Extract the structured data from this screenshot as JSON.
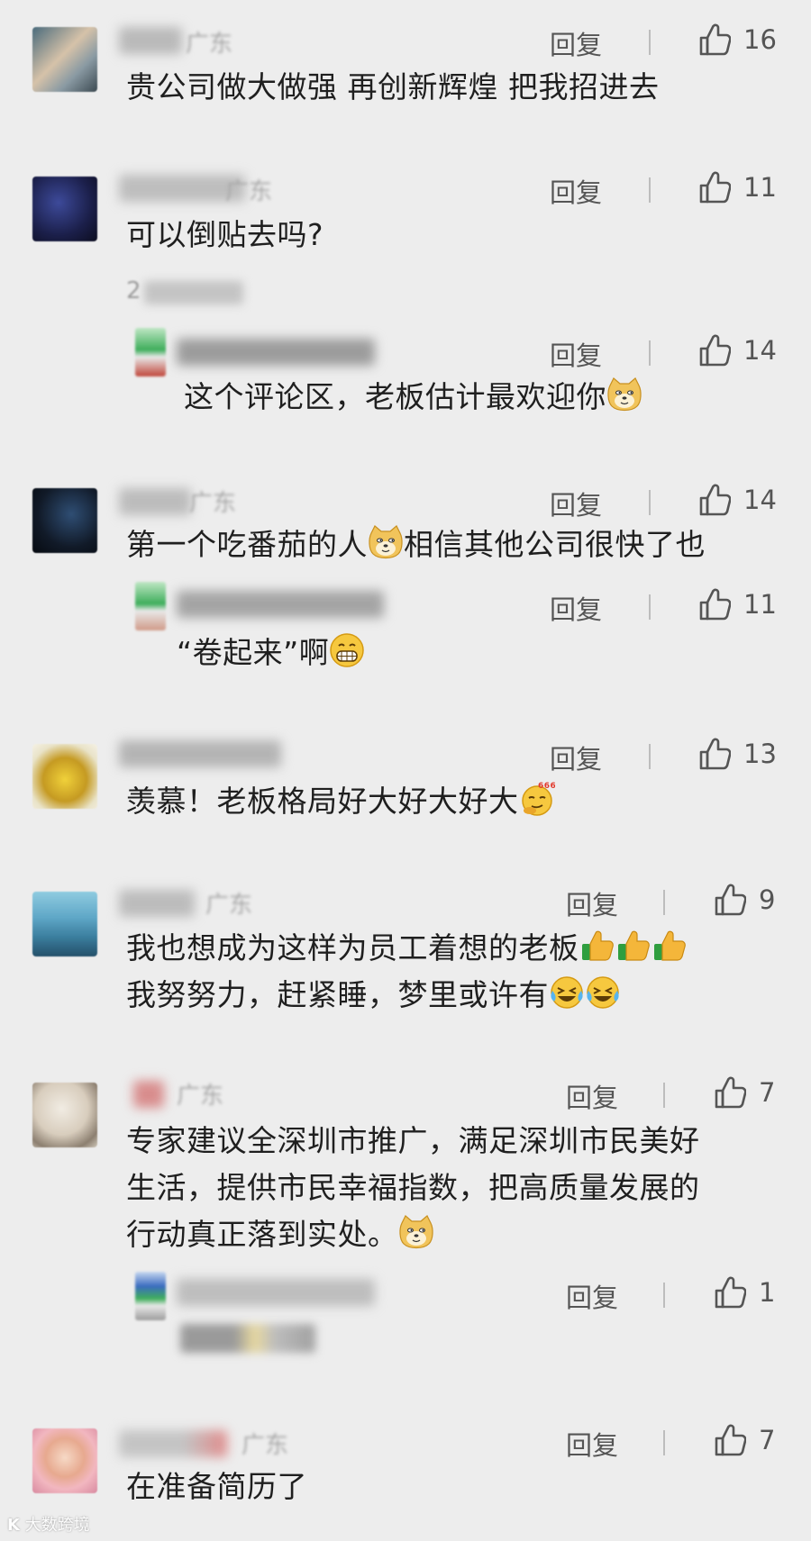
{
  "reply_label": "回复",
  "comments": [
    {
      "region": "广东",
      "likes": "16",
      "text": "贵公司做大做强 再创新辉煌 把我招进去"
    },
    {
      "region": "广东",
      "likes": "11",
      "text": "可以倒贴去吗?",
      "more": "2"
    },
    {
      "likes": "14",
      "text": "这个评论区，老板估计最欢迎你"
    },
    {
      "region": "广东",
      "likes": "14",
      "text_a": "第一个吃番茄的人",
      "text_b": "相信其他公司很快了也"
    },
    {
      "likes": "11",
      "text": "“卷起来”啊"
    },
    {
      "likes": "13",
      "text": "羡慕！老板格局好大好大好大"
    },
    {
      "region": "广东",
      "likes": "9",
      "line1": "我也想成为这样为员工着想的老板",
      "line2": "我努努力，赶紧睡，梦里或许有"
    },
    {
      "region": "广东",
      "likes": "7",
      "line1": "专家建议全深圳市推广，满足深圳市民美好",
      "line2": "生活，提供市民幸福指数，把高质量发展的",
      "line3": "行动真正落到实处。"
    },
    {
      "likes": "1"
    },
    {
      "region": "广东",
      "likes": "7",
      "text": "在准备简历了"
    }
  ],
  "watermark": "大数跨境",
  "colors": {
    "background": "#ededed",
    "text": "#1f1f1f",
    "action": "#555555"
  }
}
